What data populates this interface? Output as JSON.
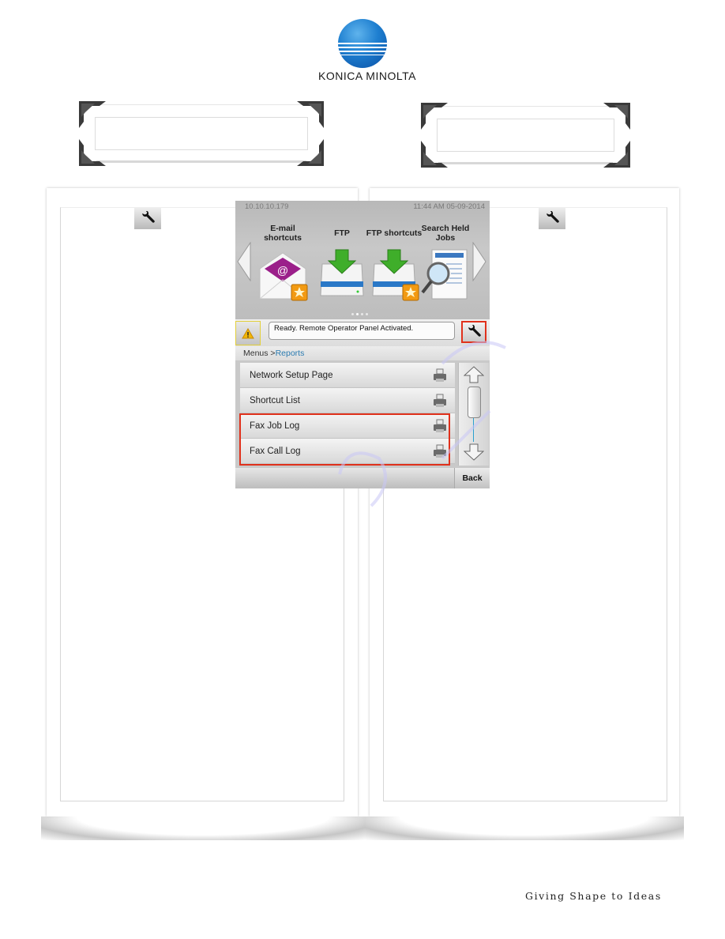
{
  "brand": {
    "name": "KONICA MINOLTA",
    "tagline": "Giving Shape to Ideas",
    "logo_color": "#1e7fd0"
  },
  "device_screen": {
    "ip_address": "10.10.10.179",
    "datetime": "11:44 AM 05-09-2014",
    "apps": [
      {
        "label": "E-mail shortcuts",
        "icon": "email-envelope-icon",
        "favorite": true
      },
      {
        "label": "FTP",
        "icon": "ftp-drive-icon",
        "favorite": false
      },
      {
        "label": "FTP shortcuts",
        "icon": "ftp-drive-icon",
        "favorite": true
      },
      {
        "label": "Search Held Jobs",
        "icon": "search-document-icon",
        "favorite": false
      }
    ],
    "page_indicator": {
      "pages": 4,
      "current": 2
    },
    "status_message": "Ready. Remote Operator Panel Activated.",
    "breadcrumb": {
      "parent": "Menus >",
      "current": "Reports"
    },
    "menu_items": [
      {
        "label": "Network Setup Page",
        "icon": "printer-icon",
        "highlighted": false
      },
      {
        "label": "Shortcut List",
        "icon": "printer-icon",
        "highlighted": false
      },
      {
        "label": "Fax Job Log",
        "icon": "printer-icon",
        "highlighted": true
      },
      {
        "label": "Fax Call Log",
        "icon": "printer-icon",
        "highlighted": true
      }
    ],
    "back_label": "Back",
    "highlight_color": "#e0311c",
    "link_color": "#2a7bb0"
  },
  "panels": [
    {
      "id": "left",
      "icon": "wrench-icon"
    },
    {
      "id": "right",
      "icon": "wrench-icon"
    }
  ]
}
